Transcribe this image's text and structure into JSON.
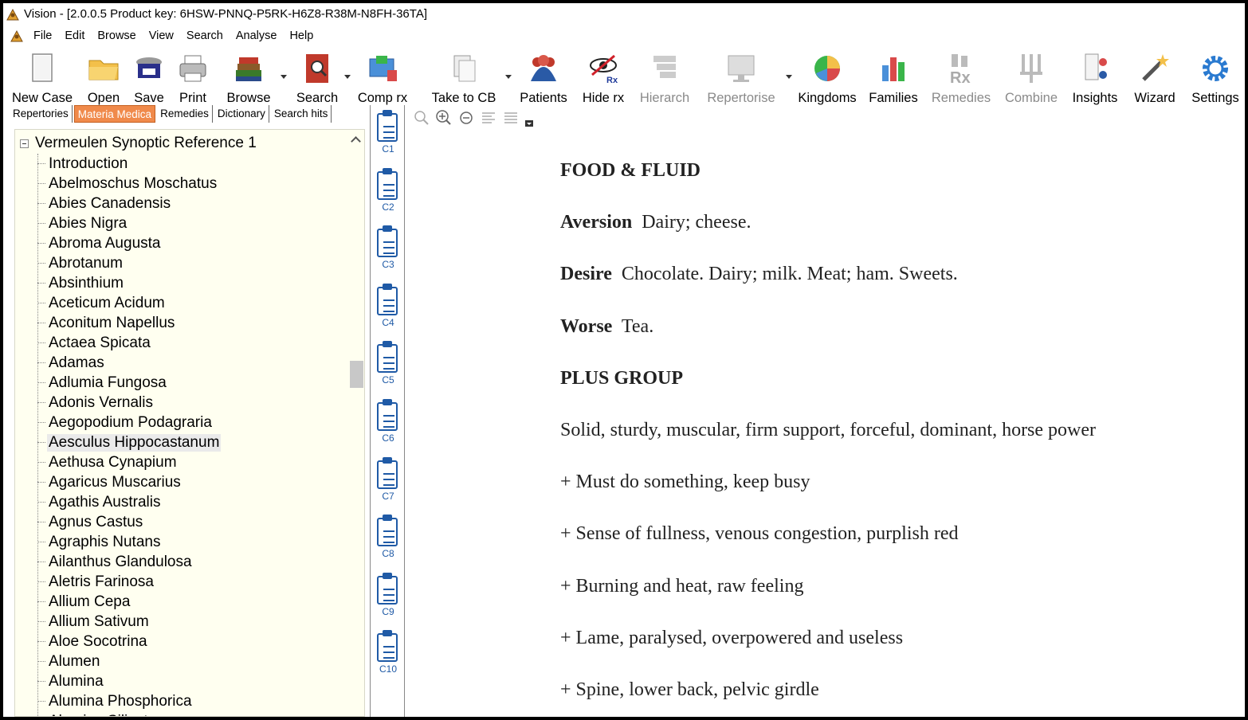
{
  "window": {
    "title": "Vision - [2.0.0.5 Product key: 6HSW-PNNQ-P5RK-H6Z8-R38M-N8FH-36TA]"
  },
  "menu": [
    "File",
    "Edit",
    "Browse",
    "View",
    "Search",
    "Analyse",
    "Help"
  ],
  "toolbar": {
    "new_case": "New Case",
    "open": "Open",
    "save": "Save",
    "print": "Print",
    "browse": "Browse",
    "search": "Search",
    "comp_rx": "Comp rx",
    "take_to_cb": "Take to CB",
    "patients": "Patients",
    "hide_rx": "Hide rx",
    "hierarch": "Hierarch",
    "repertorise": "Repertorise",
    "kingdoms": "Kingdoms",
    "families": "Families",
    "remedies": "Remedies",
    "combine": "Combine",
    "insights": "Insights",
    "wizard": "Wizard",
    "settings": "Settings",
    "hide_rx_badge": "Rx",
    "remedies_badge": "Rx"
  },
  "tabs": [
    "Repertories",
    "Materia Medica",
    "Remedies",
    "Dictionary",
    "Search hits"
  ],
  "active_tab": "Materia Medica",
  "tree": {
    "root": "Vermeulen Synoptic Reference 1",
    "items": [
      "Introduction",
      "Abelmoschus Moschatus",
      "Abies Canadensis",
      "Abies Nigra",
      "Abroma Augusta",
      "Abrotanum",
      "Absinthium",
      "Aceticum Acidum",
      "Aconitum Napellus",
      "Actaea Spicata",
      "Adamas",
      "Adlumia Fungosa",
      "Adonis Vernalis",
      "Aegopodium Podagraria",
      "Aesculus Hippocastanum",
      "Aethusa Cynapium",
      "Agaricus Muscarius",
      "Agathis Australis",
      "Agnus Castus",
      "Agraphis Nutans",
      "Ailanthus Glandulosa",
      "Aletris Farinosa",
      "Allium Cepa",
      "Allium Sativum",
      "Aloe Socotrina",
      "Alumen",
      "Alumina",
      "Alumina Phosphorica",
      "Alumina Silicata"
    ],
    "selected": "Aesculus Hippocastanum"
  },
  "clipboards": [
    "C1",
    "C2",
    "C3",
    "C4",
    "C5",
    "C6",
    "C7",
    "C8",
    "C9",
    "C10"
  ],
  "content": {
    "heading_food": "FOOD & FLUID",
    "aversion_label": "Aversion",
    "aversion_text": "Dairy; cheese.",
    "desire_label": "Desire",
    "desire_text": "Chocolate. Dairy; milk. Meat; ham. Sweets.",
    "worse_label": "Worse",
    "worse_text": "Tea.",
    "heading_plus": "PLUS GROUP",
    "lines": [
      "Solid, sturdy, muscular, firm support, forceful, dominant, horse power",
      "+ Must do something, keep busy",
      "+ Sense of fullness, venous congestion, purplish red",
      "+ Burning and heat, raw feeling",
      "+ Lame, paralysed, overpowered and useless",
      "+ Spine, lower back, pelvic girdle"
    ]
  },
  "colors": {
    "active_tab": "#f08a4b",
    "tree_bg": "#fffff0",
    "clipboard_blue": "#1f5aa6"
  }
}
